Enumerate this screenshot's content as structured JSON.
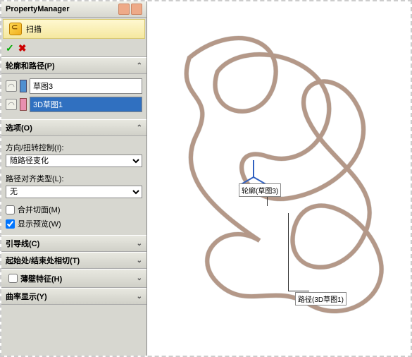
{
  "header": {
    "title": "PropertyManager"
  },
  "feature": {
    "name": "扫描"
  },
  "sections": {
    "profile_path": {
      "title": "轮廓和路径(P)",
      "profile": "草图3",
      "path": "3D草图1"
    },
    "options": {
      "title": "选项(O)",
      "twist_label": "方向/扭转控制(I):",
      "twist_value": "随路径变化",
      "align_label": "路径对齐类型(L):",
      "align_value": "无",
      "merge_faces": "合并切面(M)",
      "show_preview": "显示预览(W)"
    },
    "guides": {
      "title": "引导线(C)"
    },
    "tangency": {
      "title": "起始处/结束处相切(T)"
    },
    "thin": {
      "title": "薄壁特征(H)"
    },
    "curvature": {
      "title": "曲率显示(Y)"
    }
  },
  "callouts": {
    "profile": "轮廓(草图3)",
    "path": "路径(3D草图1)"
  },
  "checkbox_states": {
    "merge": false,
    "preview": true
  }
}
